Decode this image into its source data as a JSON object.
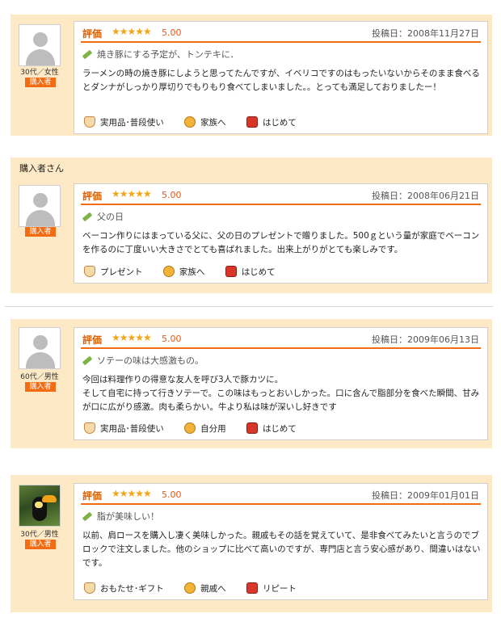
{
  "reviews": [
    {
      "age_gender": "30代／女性",
      "badge": "購入者",
      "rating_label": "評価",
      "stars": "★★★★★",
      "score": "5.00",
      "post_date": "投稿日：2008年11月27日",
      "title": "焼き豚にする予定が、トンテキに．",
      "body": "ラーメンの時の焼き豚にしようと思ってたんですが、イベリコですのはもったいないからそのまま食べるとダンナがしっかり厚切りでもりもり食べてしまいました。。とっても満足しておりましたー！",
      "tags": [
        {
          "icon": "hand-icon",
          "label": "実用品･普段使い"
        },
        {
          "icon": "person-icon",
          "label": "家族へ"
        },
        {
          "icon": "bag-icon",
          "label": "はじめて"
        }
      ]
    },
    {
      "reviewer_name": "購入者さん",
      "age_gender": "",
      "badge": "購入者",
      "rating_label": "評価",
      "stars": "★★★★★",
      "score": "5.00",
      "post_date": "投稿日：2008年06月21日",
      "title": "父の日",
      "body": "ベーコン作りにはまっている父に、父の日のプレゼントで贈りました。500ｇという量が家庭でベーコンを作るのに丁度いい大きさでとても喜ばれました。出来上がりがとても楽しみです。",
      "tags": [
        {
          "icon": "hand-icon",
          "label": "プレゼント"
        },
        {
          "icon": "person-icon",
          "label": "家族へ"
        },
        {
          "icon": "bag-icon",
          "label": "はじめて"
        }
      ]
    },
    {
      "age_gender": "60代／男性",
      "badge": "購入者",
      "rating_label": "評価",
      "stars": "★★★★★",
      "score": "5.00",
      "post_date": "投稿日：2009年06月13日",
      "title": "ソテーの味は大感激もの。",
      "body": "今回は料理作りの得意な友人を呼び3人で豚カツに。\nそして自宅に持って行きソテーで。この味はもっとおいしかった。口に含んで脂部分を食べた瞬間、甘みが口に広がり感激。肉も柔らかい。牛より私は味が深いし好きです",
      "tags": [
        {
          "icon": "hand-icon",
          "label": "実用品･普段使い"
        },
        {
          "icon": "person-icon",
          "label": "自分用"
        },
        {
          "icon": "bag-icon",
          "label": "はじめて"
        }
      ]
    },
    {
      "age_gender": "30代／男性",
      "badge": "購入者",
      "rating_label": "評価",
      "stars": "★★★★★",
      "score": "5.00",
      "post_date": "投稿日：2009年01月01日",
      "title": "脂が美味しい！",
      "body": "以前、肩ロースを購入し凄く美味しかった。親戚もその話を覚えていて、是非食べてみたいと言うのでブロックで注文しました。他のショップに比べて高いのですが、専門店と言う安心感があり、間違いはないです。",
      "tags": [
        {
          "icon": "hand-icon",
          "label": "おもたせ･ギフト"
        },
        {
          "icon": "person-icon",
          "label": "親戚へ"
        },
        {
          "icon": "bag-icon",
          "label": "リピート"
        }
      ]
    }
  ]
}
